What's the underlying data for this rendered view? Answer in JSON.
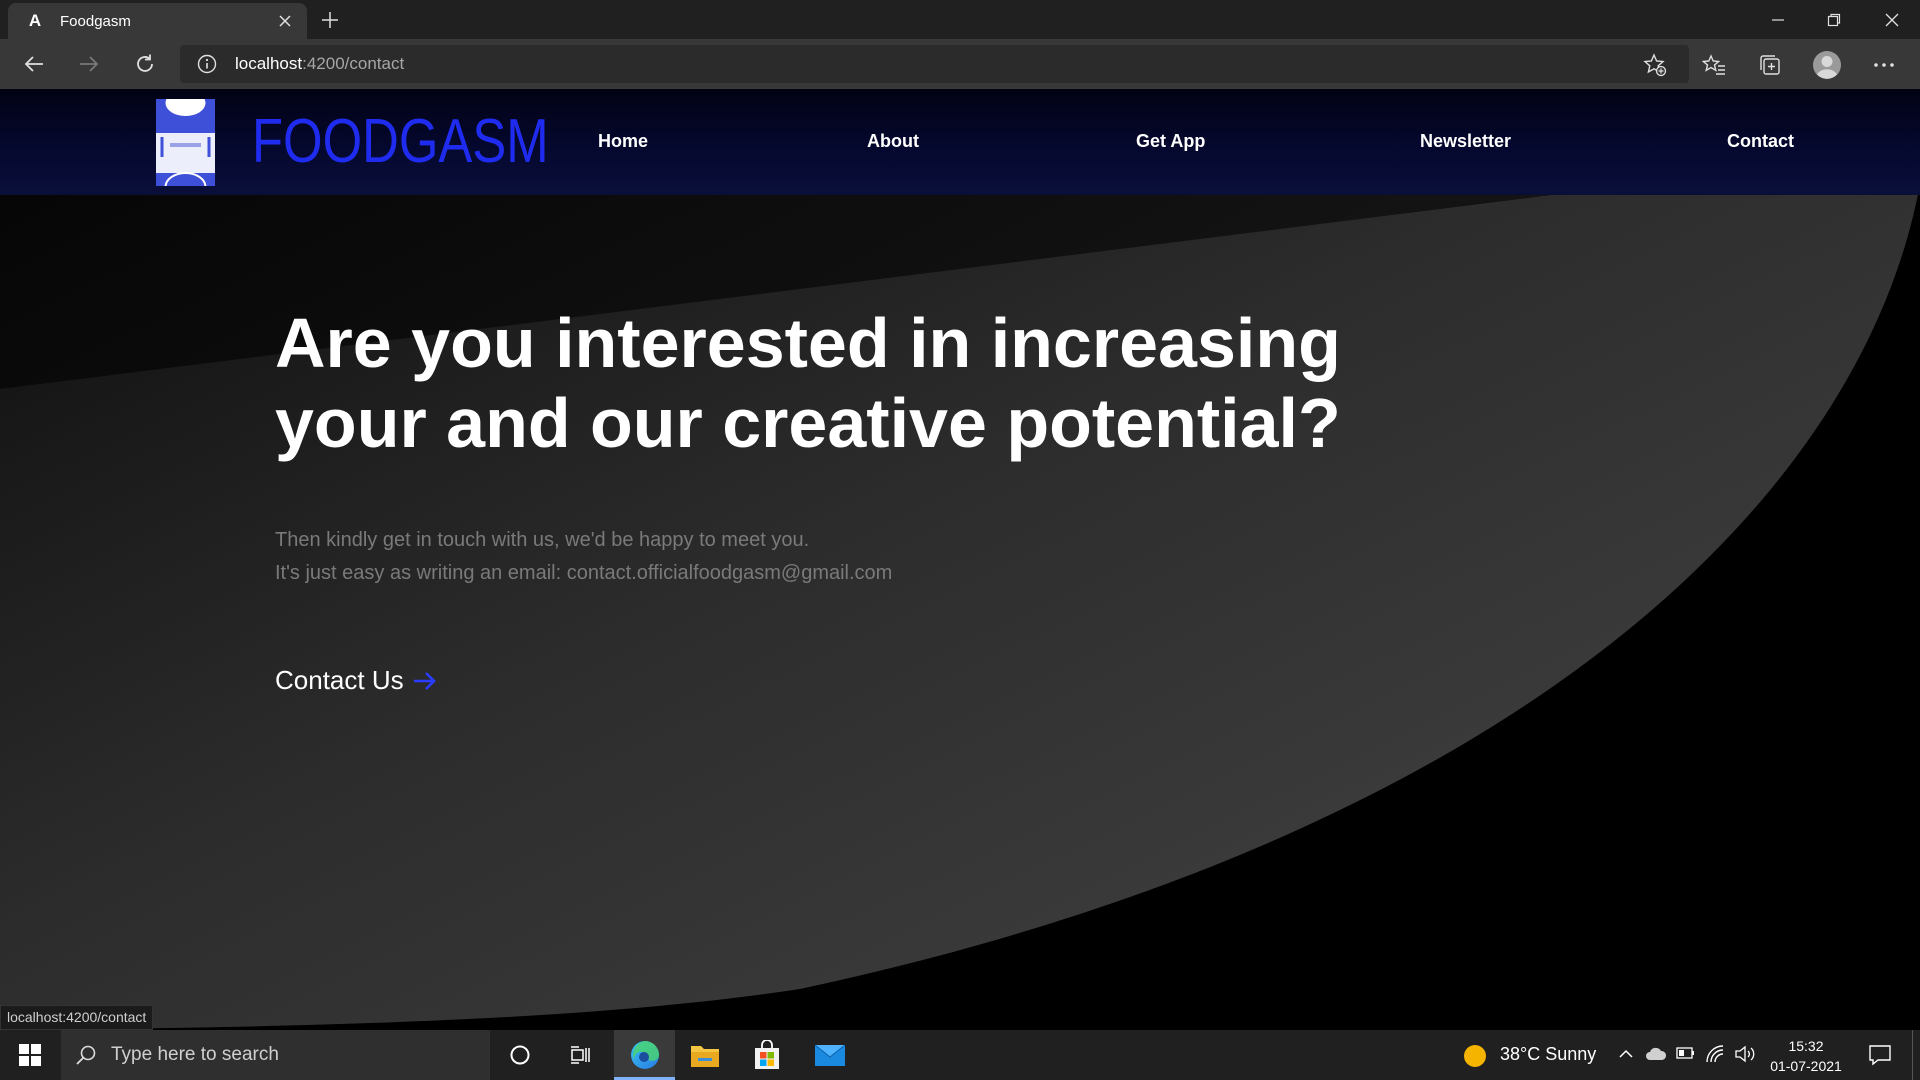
{
  "browser": {
    "tab_title": "Foodgasm",
    "tab_favicon": "A",
    "url_host": "localhost",
    "url_rest": ":4200/contact"
  },
  "site": {
    "brand": "FOODGASM",
    "nav": [
      "Home",
      "About",
      "Get App",
      "Newsletter",
      "Contact"
    ]
  },
  "hero": {
    "title_line1": "Are you interested in increasing",
    "title_line2": "your and our creative potential?",
    "sub_line1": "Then kindly get in touch with us, we'd be happy to meet you.",
    "sub_line2": "It's just easy as writing an email: contact.officialfoodgasm@gmail.com",
    "cta_label": "Contact Us"
  },
  "status_bar_text": "localhost:4200/contact",
  "taskbar": {
    "search_placeholder": "Type here to search",
    "weather": "38°C  Sunny",
    "time": "15:32",
    "date": "01-07-2021"
  },
  "colors": {
    "brand_blue": "#1f2cf0",
    "cta_arrow": "#2a3cff",
    "header_bg": "#05082e"
  }
}
